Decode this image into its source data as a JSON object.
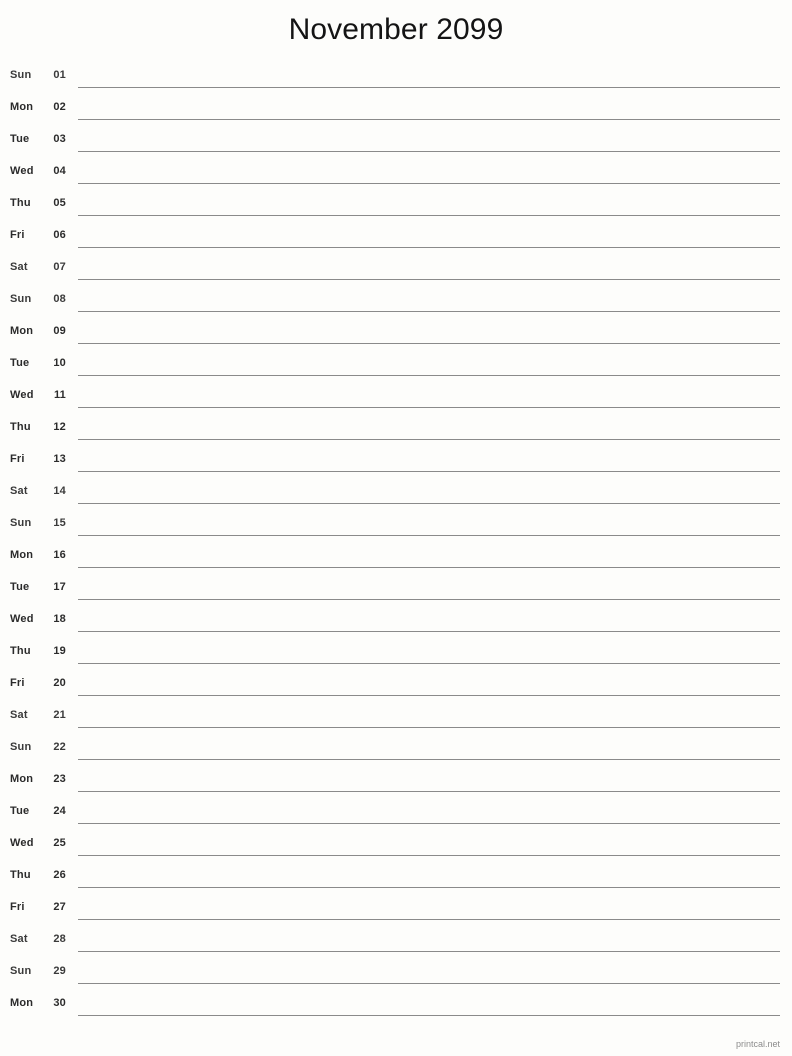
{
  "page": {
    "title": "November 2099",
    "background_color": "#fdfdfb",
    "rule_color": "#8a8a8a",
    "text_color": "#1a1a1a"
  },
  "footer": {
    "label": "printcal.net",
    "color": "#8c8c8c"
  },
  "calendar": {
    "month": "November",
    "year": "2099",
    "days": [
      {
        "weekday": "Sun",
        "date": "01",
        "weekend": true
      },
      {
        "weekday": "Mon",
        "date": "02",
        "weekend": false
      },
      {
        "weekday": "Tue",
        "date": "03",
        "weekend": false
      },
      {
        "weekday": "Wed",
        "date": "04",
        "weekend": false
      },
      {
        "weekday": "Thu",
        "date": "05",
        "weekend": false
      },
      {
        "weekday": "Fri",
        "date": "06",
        "weekend": false
      },
      {
        "weekday": "Sat",
        "date": "07",
        "weekend": true
      },
      {
        "weekday": "Sun",
        "date": "08",
        "weekend": true
      },
      {
        "weekday": "Mon",
        "date": "09",
        "weekend": false
      },
      {
        "weekday": "Tue",
        "date": "10",
        "weekend": false
      },
      {
        "weekday": "Wed",
        "date": "11",
        "weekend": false
      },
      {
        "weekday": "Thu",
        "date": "12",
        "weekend": false
      },
      {
        "weekday": "Fri",
        "date": "13",
        "weekend": false
      },
      {
        "weekday": "Sat",
        "date": "14",
        "weekend": true
      },
      {
        "weekday": "Sun",
        "date": "15",
        "weekend": true
      },
      {
        "weekday": "Mon",
        "date": "16",
        "weekend": false
      },
      {
        "weekday": "Tue",
        "date": "17",
        "weekend": false
      },
      {
        "weekday": "Wed",
        "date": "18",
        "weekend": false
      },
      {
        "weekday": "Thu",
        "date": "19",
        "weekend": false
      },
      {
        "weekday": "Fri",
        "date": "20",
        "weekend": false
      },
      {
        "weekday": "Sat",
        "date": "21",
        "weekend": true
      },
      {
        "weekday": "Sun",
        "date": "22",
        "weekend": true
      },
      {
        "weekday": "Mon",
        "date": "23",
        "weekend": false
      },
      {
        "weekday": "Tue",
        "date": "24",
        "weekend": false
      },
      {
        "weekday": "Wed",
        "date": "25",
        "weekend": false
      },
      {
        "weekday": "Thu",
        "date": "26",
        "weekend": false
      },
      {
        "weekday": "Fri",
        "date": "27",
        "weekend": false
      },
      {
        "weekday": "Sat",
        "date": "28",
        "weekend": true
      },
      {
        "weekday": "Sun",
        "date": "29",
        "weekend": true
      },
      {
        "weekday": "Mon",
        "date": "30",
        "weekend": false
      }
    ]
  }
}
